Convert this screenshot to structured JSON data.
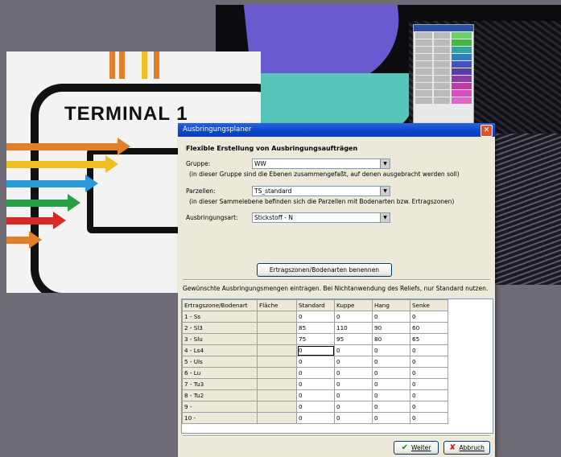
{
  "dialog": {
    "title": "Ausbringungsplaner",
    "heading": "Flexible Erstellung von Ausbringungsaufträgen",
    "gruppe_label": "Gruppe:",
    "gruppe_value": "WW",
    "gruppe_hint": "(in dieser Gruppe sind die Ebenen zusammengefaßt, auf denen ausgebracht werden soll)",
    "parzellen_label": "Parzellen:",
    "parzellen_value": "TS_standard",
    "parzellen_hint": "(in dieser Sammelebene befinden sich die Parzellen mit Bodenarten bzw. Ertragszonen)",
    "ausbringungsart_label": "Ausbringungsart:",
    "ausbringungsart_value": "Stickstoff - N",
    "ertragszonen_button": "Ertragszonen/Bodenarten benennen",
    "instruction": "Gewünschte Ausbringungsmengen eintragen. Bei Nichtanwendung des Reliefs, nur Standard nutzen.",
    "weiter_button": "Weiter",
    "abbruch_button": "Abbruch"
  },
  "table": {
    "columns": [
      "Ertragszone/Bodenart",
      "Fläche",
      "Standard",
      "Kuppe",
      "Hang",
      "Senke"
    ],
    "rows": [
      [
        "1 - Ss",
        "",
        "0",
        "0",
        "0",
        "0"
      ],
      [
        "2 - Sl3",
        "",
        "85",
        "110",
        "90",
        "60"
      ],
      [
        "3 - Slu",
        "",
        "75",
        "95",
        "80",
        "65"
      ],
      [
        "4 - Ls4",
        "",
        "0",
        "0",
        "0",
        "0"
      ],
      [
        "5 - Uls",
        "",
        "0",
        "0",
        "0",
        "0"
      ],
      [
        "6 - Lu",
        "",
        "0",
        "0",
        "0",
        "0"
      ],
      [
        "7 - Tu3",
        "",
        "0",
        "0",
        "0",
        "0"
      ],
      [
        "8 - Tu2",
        "",
        "0",
        "0",
        "0",
        "0"
      ],
      [
        "9 -",
        "",
        "0",
        "0",
        "0",
        "0"
      ],
      [
        "10 -",
        "",
        "0",
        "0",
        "0",
        "0"
      ]
    ]
  },
  "poster": {
    "title": "TERMINAL 1"
  },
  "icons": {
    "close": "close-icon",
    "ok": "checkmark-icon",
    "cancel": "x-icon",
    "dropdown": "chevron-down-icon"
  },
  "colors": {
    "titlebar": "#0a44c8",
    "dialog_bg": "#ece9d8",
    "close_btn": "#d9562f"
  }
}
